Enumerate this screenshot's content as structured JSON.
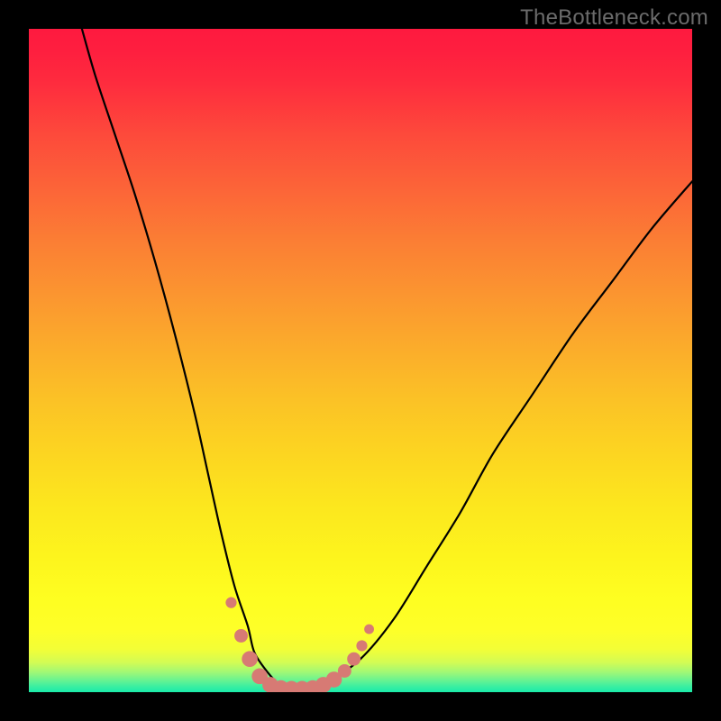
{
  "watermark": "TheBottleneck.com",
  "chart_data": {
    "type": "line",
    "title": "",
    "xlabel": "",
    "ylabel": "",
    "xlim": [
      0,
      100
    ],
    "ylim": [
      0,
      100
    ],
    "series": [
      {
        "name": "bottleneck-curve",
        "x": [
          8,
          10,
          13,
          16,
          19,
          22,
          25,
          27,
          29,
          31,
          33,
          34,
          36,
          38,
          40,
          42,
          45,
          50,
          55,
          60,
          65,
          70,
          76,
          82,
          88,
          94,
          100
        ],
        "y": [
          100,
          93,
          84,
          75,
          65,
          54,
          42,
          33,
          24,
          16,
          10,
          6,
          3,
          1,
          0.5,
          0.5,
          1.5,
          5,
          11,
          19,
          27,
          36,
          45,
          54,
          62,
          70,
          77
        ]
      }
    ],
    "markers": {
      "name": "highlight-points",
      "color": "#d77a74",
      "points": [
        {
          "x": 30.5,
          "y": 13.5,
          "r": 0.9
        },
        {
          "x": 32.0,
          "y": 8.5,
          "r": 1.1
        },
        {
          "x": 33.3,
          "y": 5.0,
          "r": 1.3
        },
        {
          "x": 34.8,
          "y": 2.4,
          "r": 1.3
        },
        {
          "x": 36.4,
          "y": 1.1,
          "r": 1.3
        },
        {
          "x": 38.0,
          "y": 0.6,
          "r": 1.3
        },
        {
          "x": 39.6,
          "y": 0.5,
          "r": 1.3
        },
        {
          "x": 41.2,
          "y": 0.5,
          "r": 1.3
        },
        {
          "x": 42.8,
          "y": 0.6,
          "r": 1.3
        },
        {
          "x": 44.4,
          "y": 1.1,
          "r": 1.3
        },
        {
          "x": 46.0,
          "y": 1.9,
          "r": 1.3
        },
        {
          "x": 47.6,
          "y": 3.2,
          "r": 1.1
        },
        {
          "x": 49.0,
          "y": 5.0,
          "r": 1.1
        },
        {
          "x": 50.2,
          "y": 7.0,
          "r": 0.9
        },
        {
          "x": 51.3,
          "y": 9.5,
          "r": 0.8
        }
      ]
    },
    "background_gradient": {
      "stops": [
        {
          "pos": 0.0,
          "color": "#fe1a3f"
        },
        {
          "pos": 0.03,
          "color": "#fe1e3f"
        },
        {
          "pos": 0.08,
          "color": "#fe2b3e"
        },
        {
          "pos": 0.16,
          "color": "#fd4a3b"
        },
        {
          "pos": 0.24,
          "color": "#fc6438"
        },
        {
          "pos": 0.32,
          "color": "#fb7e34"
        },
        {
          "pos": 0.4,
          "color": "#fb9530"
        },
        {
          "pos": 0.48,
          "color": "#fbac2b"
        },
        {
          "pos": 0.56,
          "color": "#fbc226"
        },
        {
          "pos": 0.64,
          "color": "#fcd521"
        },
        {
          "pos": 0.72,
          "color": "#fce71e"
        },
        {
          "pos": 0.8,
          "color": "#fdf51d"
        },
        {
          "pos": 0.86,
          "color": "#fefe21"
        },
        {
          "pos": 0.905,
          "color": "#feff28"
        },
        {
          "pos": 0.935,
          "color": "#f3fe36"
        },
        {
          "pos": 0.955,
          "color": "#d3fc54"
        },
        {
          "pos": 0.97,
          "color": "#a0f876"
        },
        {
          "pos": 0.982,
          "color": "#68f391"
        },
        {
          "pos": 0.992,
          "color": "#38eea2"
        },
        {
          "pos": 1.0,
          "color": "#1aeba9"
        }
      ]
    }
  }
}
